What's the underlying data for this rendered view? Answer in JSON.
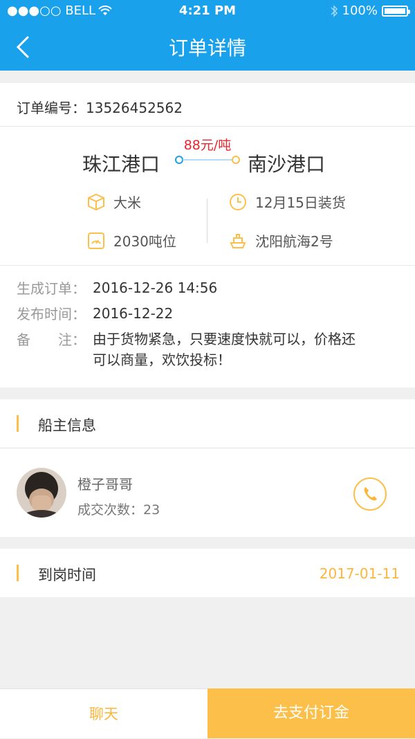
{
  "status_bar": {
    "carrier": "●●●○○ BELL",
    "time": "4:21 PM",
    "battery_text": "100%",
    "battery_level": 1.0
  },
  "nav": {
    "title": "订单详情",
    "back_icon": "chevron-left-icon"
  },
  "order": {
    "number_label": "订单编号：",
    "number": "13526452562"
  },
  "route": {
    "from_port": "珠江港口",
    "to_port": "南沙港口",
    "price": "88元/吨",
    "cargo": "大米",
    "load_date": "12月15日装货",
    "tonnage": "2030吨位",
    "ship": "沈阳航海2号"
  },
  "info": {
    "created_label": "生成订单：",
    "created_value": "2016-12-26  14:56",
    "published_label": "发布时间：",
    "published_value": "2016-12-22",
    "note_label": "备　　注：",
    "note_line1": "由于货物紧急，只要速度快就可以，价格还",
    "note_line2": "可以商量，欢饮投标！"
  },
  "owner_section": {
    "title": "船主信息"
  },
  "owner": {
    "name": "橙子哥哥",
    "deal_count_label": "成交次数：",
    "deal_count": "23"
  },
  "arrival": {
    "title": "到岗时间",
    "date": "2017-01-11"
  },
  "actions": {
    "chat": "聊天",
    "pay": "去支付订金"
  },
  "colors": {
    "primary": "#1aa1eb",
    "accent": "#fcc04a",
    "price": "#e8262e"
  }
}
